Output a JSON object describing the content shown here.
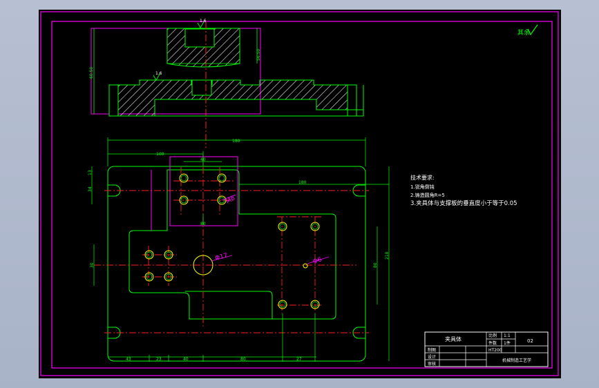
{
  "colors": {
    "background": "#000000",
    "border": "#ff00ff",
    "geometry": "#00ff00",
    "hatch": "#ffffff",
    "centerline": "#ff2020",
    "holes": "#ffff00",
    "dimension": "#00ff00",
    "text": "#ffffff",
    "callout": "#ff00ff"
  },
  "surface_finish_note": "其余",
  "top_view": {
    "roughness_top": "1.6",
    "roughness_left": "1.6",
    "dim_left": "60.50",
    "dim_right": "56.50"
  },
  "plan_view": {
    "dim_overall_width": "180",
    "dim_upper_left": "100",
    "dim_inner_width": "40",
    "dim_mid_row": "180",
    "dim_left_top": "13",
    "dim_left_upper": "34",
    "dim_left_mid": "30",
    "dim_right_height": "80",
    "dim_right_overall": "210",
    "dim_center": "80",
    "thread_callout": "M8",
    "bore_callout": "Φ17",
    "pin_callout": "Φ6",
    "bottom_dims": [
      "43",
      "23",
      "40",
      "80",
      "27"
    ]
  },
  "technical_requirements": {
    "title": "技术要求:",
    "items": [
      "1.锐角倒钝",
      "2.铸造圆角R=5",
      "3.夹具体与支撑板的垂直度小于等于0.05"
    ]
  },
  "title_block": {
    "part_name": "夹具体",
    "scale_label": "比例",
    "scale_value": "1:1",
    "count_label": "件数",
    "count_value": "1件",
    "material_value": "HT200",
    "drawing_no": "02",
    "drawn_label": "制图",
    "designer_label": "设计",
    "reviewer_label": "审核",
    "school": "机械制造工艺学"
  }
}
